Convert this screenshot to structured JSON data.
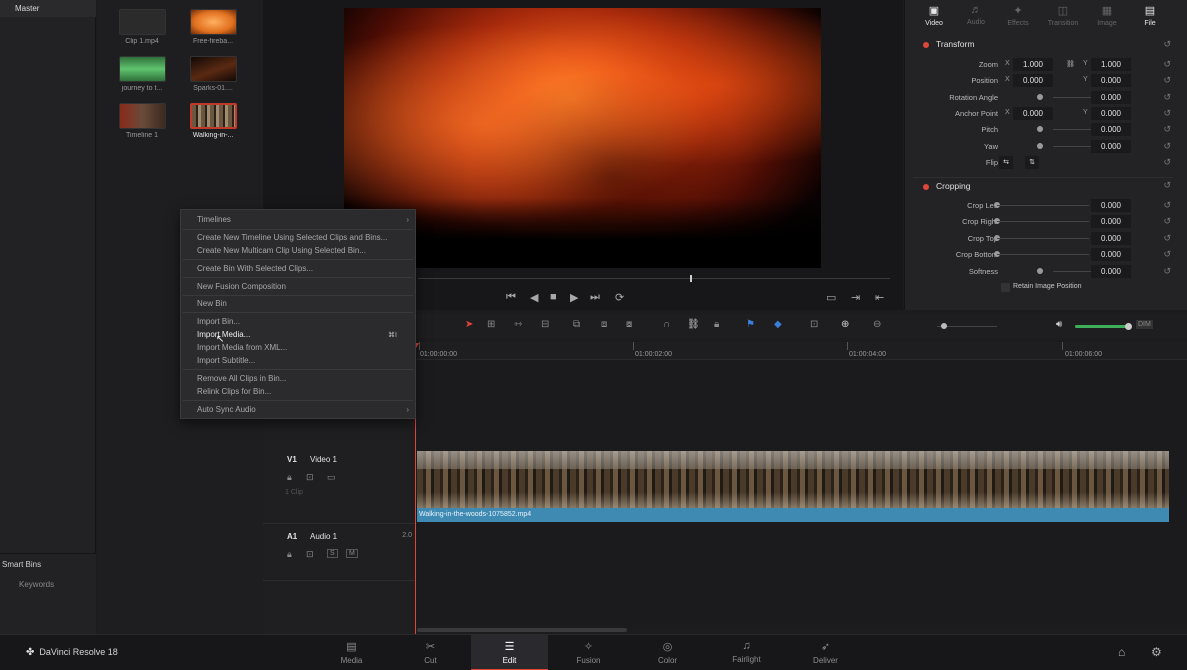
{
  "bins": {
    "master": "Master",
    "smart_bins": "Smart Bins",
    "keywords": "Keywords"
  },
  "clips": [
    {
      "label": "Clip 1.mp4",
      "color": "#2b2b2b"
    },
    {
      "label": "Free-fireba...",
      "color": "#e0701f"
    },
    {
      "label": "journey to t...",
      "color": "#4aa35a"
    },
    {
      "label": "Sparks-01....",
      "color": "#3a1a10"
    },
    {
      "label": "Timeline 1",
      "color": "#6a3a2a"
    },
    {
      "label": "Walking-in-...",
      "color": "#7a5a40",
      "selected": true
    }
  ],
  "context_menu": {
    "items": [
      {
        "label": "Timelines",
        "submenu": true
      },
      {
        "label": "Create New Timeline Using Selected Clips and Bins..."
      },
      {
        "label": "Create New Multicam Clip Using Selected Bin..."
      },
      {
        "label": "Create Bin With Selected Clips..."
      },
      {
        "label": "New Fusion Composition"
      },
      {
        "label": "New Bin"
      },
      {
        "label": "Import Bin..."
      },
      {
        "label": "Import Media...",
        "shortcut": "⌘I",
        "hovered": true
      },
      {
        "label": "Import Media from XML..."
      },
      {
        "label": "Import Subtitle..."
      },
      {
        "label": "Remove All Clips in Bin..."
      },
      {
        "label": "Relink Clips for Bin..."
      },
      {
        "label": "Auto Sync Audio",
        "submenu": true
      }
    ]
  },
  "inspector": {
    "tabs": [
      "Video",
      "Audio",
      "Effects",
      "Transition",
      "Image",
      "File"
    ],
    "active_tab": "Video",
    "transform": {
      "title": "Transform",
      "zoom": {
        "label": "Zoom",
        "x": "1.000",
        "y": "1.000"
      },
      "position": {
        "label": "Position",
        "x": "0.000",
        "y": "0.000"
      },
      "rotation": {
        "label": "Rotation Angle",
        "value": "0.000"
      },
      "anchor": {
        "label": "Anchor Point",
        "x": "0.000",
        "y": "0.000"
      },
      "pitch": {
        "label": "Pitch",
        "value": "0.000"
      },
      "yaw": {
        "label": "Yaw",
        "value": "0.000"
      },
      "flip": {
        "label": "Flip"
      }
    },
    "cropping": {
      "title": "Cropping",
      "left": {
        "label": "Crop Left",
        "value": "0.000"
      },
      "right": {
        "label": "Crop Right",
        "value": "0.000"
      },
      "top": {
        "label": "Crop Top",
        "value": "0.000"
      },
      "bottom": {
        "label": "Crop Bottom",
        "value": "0.000"
      },
      "softness": {
        "label": "Softness",
        "value": "0.000"
      },
      "retain": "Retain Image Position"
    },
    "axis_x": "X",
    "axis_y": "Y"
  },
  "timeline": {
    "timecodes": [
      "01:00:00:00",
      "01:00:02:00",
      "01:00:04:00",
      "01:00:06:00"
    ],
    "video_track": {
      "id": "V1",
      "name": "Video 1",
      "clip_count": "1 Clip"
    },
    "audio_track": {
      "id": "A1",
      "name": "Audio 1",
      "level": "2.0"
    },
    "clip_name": "Walking-in-the-woods-1075852.mp4",
    "audio_meter_label": "DIM"
  },
  "bottom_bar": {
    "brand": "DaVinci Resolve 18",
    "pages": [
      "Media",
      "Cut",
      "Edit",
      "Fusion",
      "Color",
      "Fairlight",
      "Deliver"
    ],
    "active_page": "Edit"
  }
}
